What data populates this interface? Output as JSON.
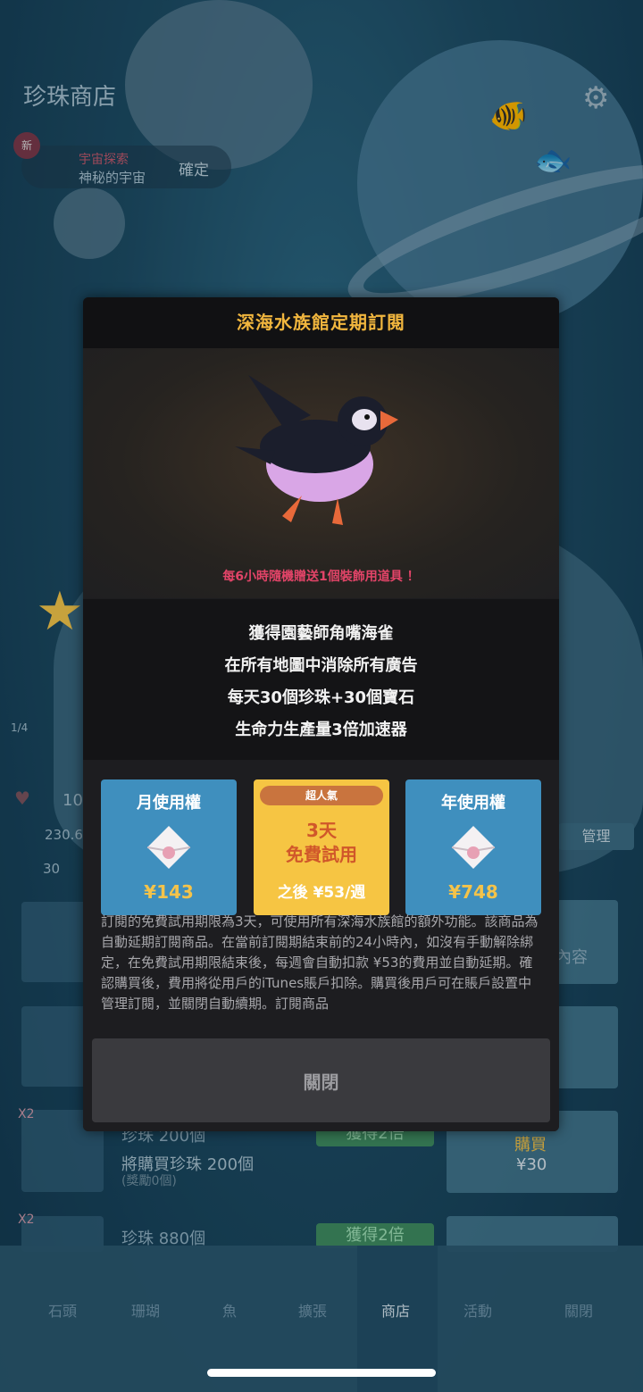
{
  "background": {
    "shop_title": "珍珠商店",
    "new_badge": "新",
    "pill_line1": "宇宙探索",
    "pill_line2": "神秘的宇宙",
    "pill_confirm": "確定",
    "stats": {
      "page": "1/4",
      "count_a": "10",
      "count_b": "230.6",
      "count_c": "30"
    },
    "manage_label": "管理",
    "side_label": "內容",
    "rows": [
      {
        "title": "珍珠 200個",
        "desc": "將購買珍珠 200個",
        "note": "(獎勵0個)",
        "badge": "獲得2倍",
        "buy": "購買",
        "price": "¥30",
        "tag": "X2"
      },
      {
        "title": "珍珠 880個",
        "badge": "獲得2倍",
        "tag": "X2"
      }
    ],
    "nav": [
      "石頭",
      "珊瑚",
      "魚",
      "擴張",
      "商店",
      "活動",
      "關閉"
    ]
  },
  "modal": {
    "title": "深海水族館定期訂閱",
    "bonus": "每6小時隨機贈送1個裝飾用道具 ！",
    "features": [
      "獲得園藝師角嘴海雀",
      "在所有地圖中消除所有廣告",
      "每天30個珍珠+30個寶石",
      "生命力生產量3倍加速器"
    ],
    "plans": {
      "monthly": {
        "title": "月使用權",
        "price": "¥143"
      },
      "trial": {
        "badge": "超人氣",
        "line1": "3天",
        "line2": "免費試用",
        "after": "之後 ¥53/週"
      },
      "yearly": {
        "title": "年使用權",
        "price": "¥748"
      }
    },
    "terms": "訂閱的免費試用期限為3天，可使用所有深海水族館的額外功能。該商品為自動延期訂閱商品。在當前訂閱期結束前的24小時內，如沒有手動解除綁定，在免費試用期限結束後，每週會自動扣款 ¥53的費用並自動延期。確認購買後，費用將從用戶的iTunes賬戶扣除。購買後用戶可在賬戶設置中管理訂閱，並關閉自動續期。訂閱商品",
    "close_label": "關閉"
  },
  "colors": {
    "title": "#f1b63e",
    "bonus": "#e24468",
    "plan_blue": "#3f8fbe",
    "plan_gold": "#f6c543",
    "price": "#f4c34a"
  }
}
